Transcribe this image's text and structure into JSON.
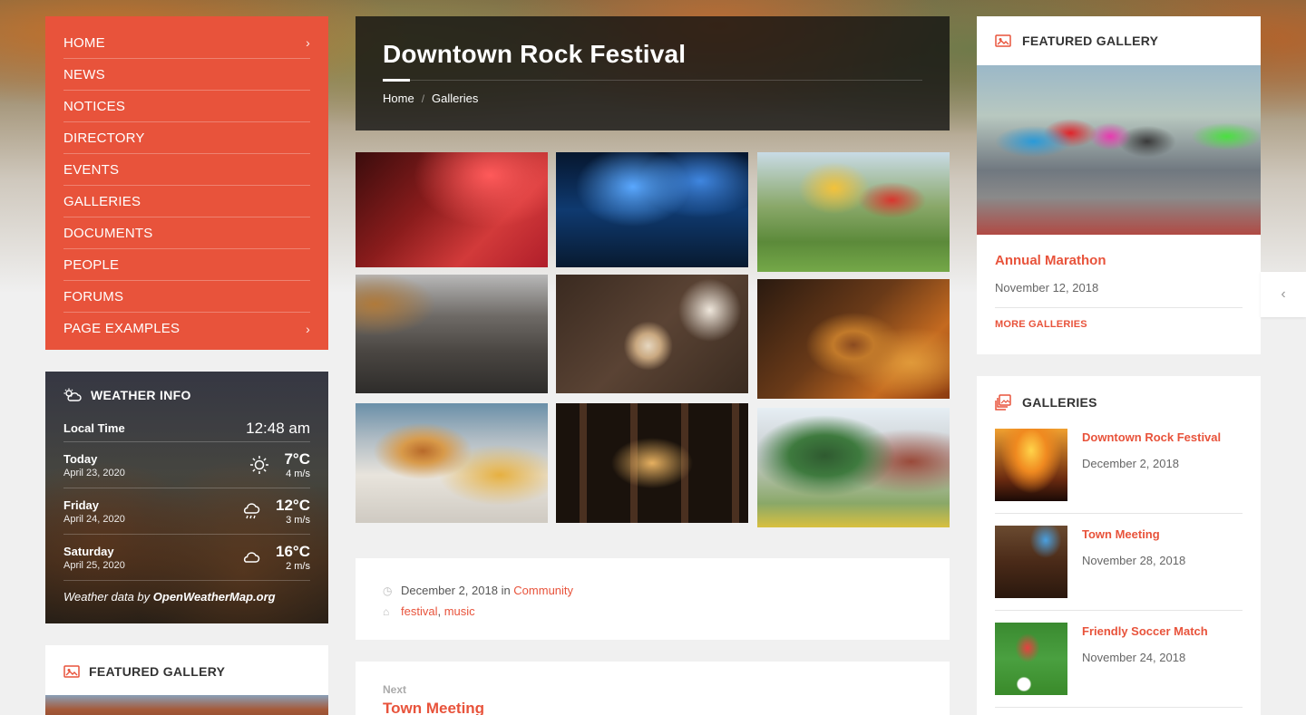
{
  "nav": {
    "items": [
      {
        "label": "HOME",
        "has_children": true
      },
      {
        "label": "NEWS",
        "has_children": false
      },
      {
        "label": "NOTICES",
        "has_children": false
      },
      {
        "label": "DIRECTORY",
        "has_children": false
      },
      {
        "label": "EVENTS",
        "has_children": false
      },
      {
        "label": "GALLERIES",
        "has_children": false
      },
      {
        "label": "DOCUMENTS",
        "has_children": false
      },
      {
        "label": "PEOPLE",
        "has_children": false
      },
      {
        "label": "FORUMS",
        "has_children": false
      },
      {
        "label": "PAGE EXAMPLES",
        "has_children": true
      }
    ]
  },
  "weather": {
    "title": "WEATHER INFO",
    "local_time_label": "Local Time",
    "local_time": "12:48 am",
    "days": [
      {
        "name": "Today",
        "date": "April 23, 2020",
        "icon": "sun-icon",
        "temp": "7°C",
        "wind": "4 m/s"
      },
      {
        "name": "Friday",
        "date": "April 24, 2020",
        "icon": "rain-cloud-icon",
        "temp": "12°C",
        "wind": "3 m/s"
      },
      {
        "name": "Saturday",
        "date": "April 25, 2020",
        "icon": "cloud-icon",
        "temp": "16°C",
        "wind": "2 m/s"
      }
    ],
    "credit_prefix": "Weather data by ",
    "credit_source": "OpenWeatherMap.org"
  },
  "featured_left": {
    "title": "FEATURED GALLERY"
  },
  "page": {
    "title": "Downtown Rock Festival",
    "breadcrumbs": [
      "Home",
      "Galleries"
    ]
  },
  "meta": {
    "date": "December 2, 2018",
    "in_word": " in ",
    "category": "Community",
    "tags": [
      "festival",
      "music"
    ],
    "tag_sep": ", "
  },
  "next": {
    "label": "Next",
    "title": "Town Meeting"
  },
  "featured_right": {
    "title": "FEATURED GALLERY",
    "item_title": "Annual Marathon",
    "item_date": "November 12, 2018",
    "more": "MORE GALLERIES"
  },
  "galleries": {
    "title": "GALLERIES",
    "items": [
      {
        "title": "Downtown Rock Festival",
        "date": "December 2, 2018"
      },
      {
        "title": "Town Meeting",
        "date": "November 28, 2018"
      },
      {
        "title": "Friendly Soccer Match",
        "date": "November 24, 2018"
      }
    ]
  },
  "colors": {
    "accent": "#e8533b",
    "dark_box": "#1a1a1a"
  }
}
